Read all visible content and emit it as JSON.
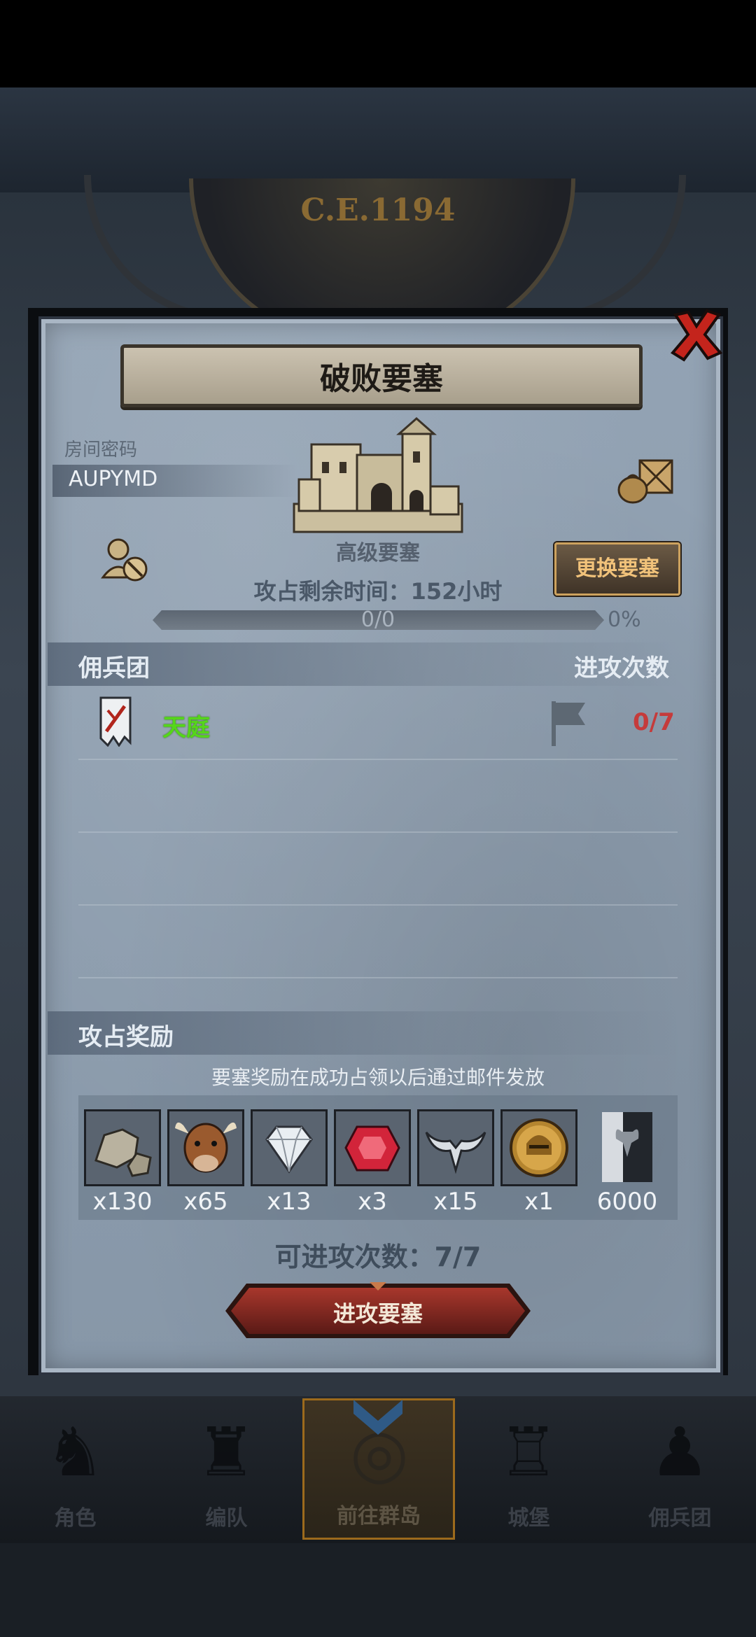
{
  "scene": {
    "era_label": "C.E.1194"
  },
  "modal": {
    "title": "破败要塞",
    "room_code_label": "房间密码",
    "room_code": "AUPYMD",
    "fortress_name": "高级要塞",
    "change_button": "更换要塞",
    "remaining_time": "攻占剩余时间：152小时",
    "progress": {
      "text": "0/0",
      "percent_text": "0%",
      "fraction": 0
    },
    "mercenary_header": "佣兵团",
    "attack_count_header": "进攻次数",
    "mercenaries": [
      {
        "name": "天庭",
        "attacks": "0/7",
        "name_color": "#55d61a",
        "count_color": "#c53b3b"
      }
    ],
    "reward_header": "攻占奖励",
    "reward_note": "要塞奖励在成功占领以后通过邮件发放",
    "rewards": [
      {
        "icon": "stone-icon",
        "qty": "x130"
      },
      {
        "icon": "cow-icon",
        "qty": "x65"
      },
      {
        "icon": "diamond-icon",
        "qty": "x13"
      },
      {
        "icon": "ruby-icon",
        "qty": "x3"
      },
      {
        "icon": "horns-icon",
        "qty": "x15"
      },
      {
        "icon": "helmet-medal-icon",
        "qty": "x1"
      },
      {
        "icon": "bull-banner-icon",
        "qty": "6000"
      }
    ],
    "attempts_text": "可进攻次数：7/7",
    "attack_button": "进攻要塞"
  },
  "nav": {
    "tabs": [
      {
        "label": "角色",
        "icon": "knight-icon"
      },
      {
        "label": "编队",
        "icon": "helmet-icon"
      },
      {
        "label": "前往群岛",
        "icon": "globe-icon",
        "active": true
      },
      {
        "label": "城堡",
        "icon": "castle-icon"
      },
      {
        "label": "佣兵团",
        "icon": "mercenary-icon"
      }
    ]
  },
  "colors": {
    "accent_gold": "#cda25e",
    "attack_red": "#8a2a24",
    "modal_bg": "#8a9aab"
  }
}
